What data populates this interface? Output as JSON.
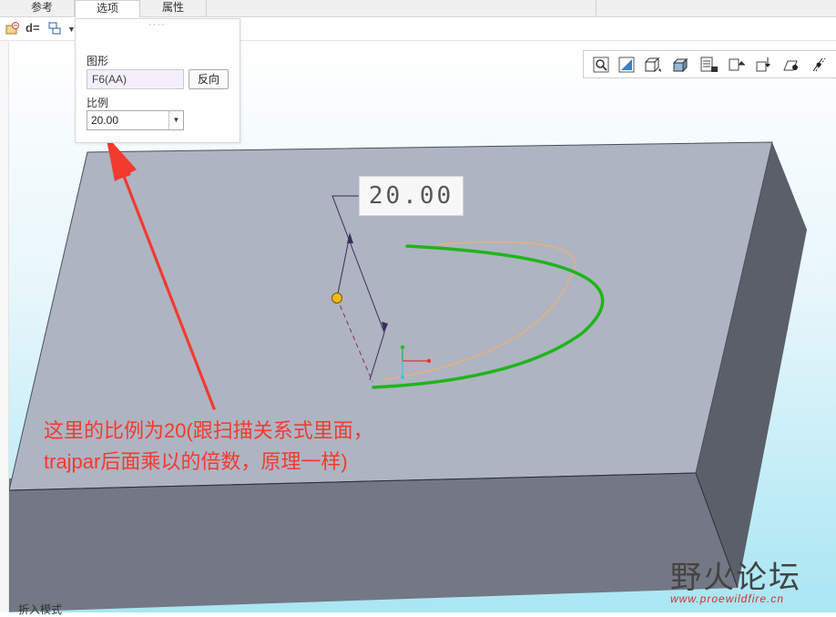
{
  "tabs": [
    {
      "label": "参考",
      "active": false
    },
    {
      "label": "选项",
      "active": true
    },
    {
      "label": "属性",
      "active": false
    }
  ],
  "toolbar": {
    "dimension_label": "d="
  },
  "options_panel": {
    "grip": "····",
    "shape_label": "图形",
    "shape_value": "F6(AA)",
    "flip_button": "反向",
    "scale_label": "比例",
    "scale_value": "20.00"
  },
  "view_toolbar": {
    "icons": [
      "zoom-icon",
      "refit-icon",
      "saved-orientations-icon",
      "display-style-icon",
      "layers-icon",
      "datum-display-icon",
      "annotation-display-icon",
      "spin-center-icon",
      "named-views-icon",
      "section-icon"
    ]
  },
  "model": {
    "dimension_text": "20.00",
    "colors": {
      "block_top": "#aeb4c2",
      "block_front": "#737884",
      "block_right": "#5b5f6a",
      "curve": "#1fb51a",
      "preview_curve": "#e8b07a"
    }
  },
  "annotation": {
    "text": "这里的比例为20(跟扫描关系式里面，\ntrajpar后面乘以的倍数，原理一样)",
    "color": "#f23a2e"
  },
  "watermark": {
    "text": "野火论坛",
    "url": "www.proewildfire.cn"
  },
  "status": {
    "text": "折入模式"
  }
}
